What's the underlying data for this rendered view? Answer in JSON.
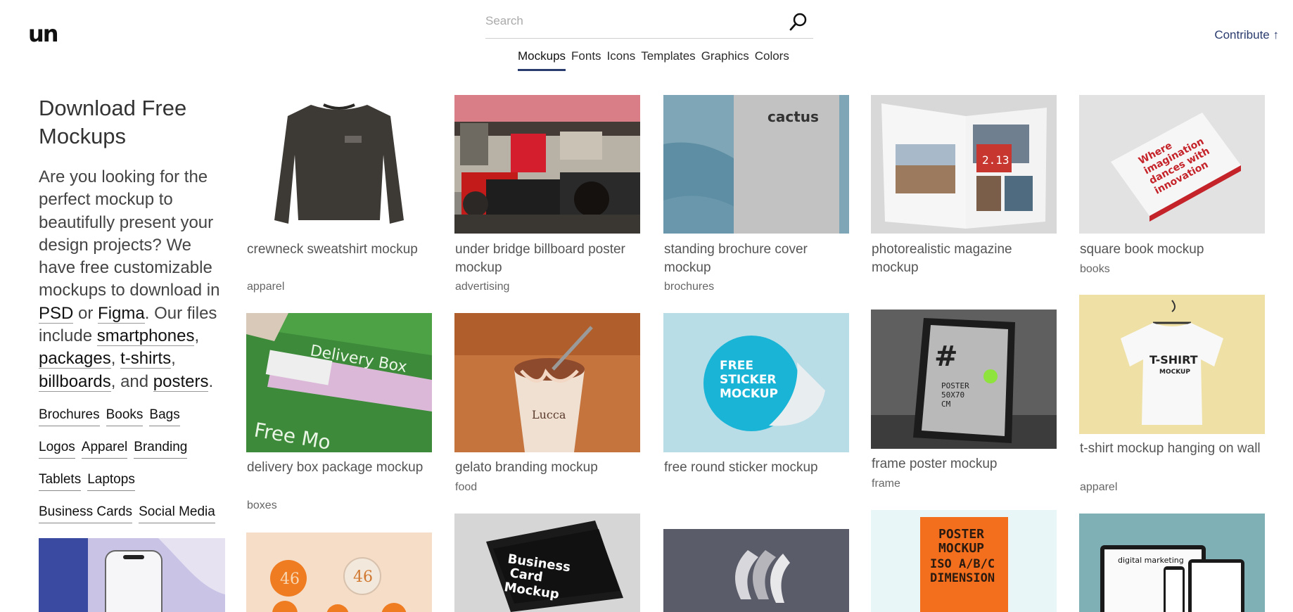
{
  "header": {
    "logo": "un",
    "search_placeholder": "Search",
    "contribute": "Contribute ↑"
  },
  "nav": {
    "tabs": [
      {
        "label": "Mockups",
        "active": true
      },
      {
        "label": "Fonts"
      },
      {
        "label": "Icons"
      },
      {
        "label": "Templates"
      },
      {
        "label": "Graphics"
      },
      {
        "label": "Colors"
      }
    ]
  },
  "sidebar": {
    "title": "Download Free Mockups",
    "intro": {
      "part1": "Are you looking for the perfect mockup to beautifully present your design projects? We have free customizable mockups to download in ",
      "psd": "PSD",
      "or": " or ",
      "figma": "Figma",
      "part2": ". Our files include ",
      "smartphones": "smartphones",
      "c1": ", ",
      "packages": "packages",
      "c2": ", ",
      "tshirts": "t-shirts",
      "c3": ", ",
      "billboards": "billboards",
      "and": ", and ",
      "posters": "posters",
      "end": "."
    },
    "tags": [
      [
        "Brochures",
        "Books",
        "Bags"
      ],
      [
        "Logos",
        "Apparel",
        "Branding"
      ],
      [
        "Tablets",
        "Laptops"
      ],
      [
        "Business Cards",
        "Social Media"
      ]
    ]
  },
  "cards": [
    {
      "title": "crewneck sweatshirt mockup",
      "tag": "apparel"
    },
    {
      "title": "under bridge billboard poster mockup",
      "tag": "advertising"
    },
    {
      "title": "standing brochure cover mockup",
      "tag": "brochures"
    },
    {
      "title": "photorealistic magazine mockup",
      "tag": ""
    },
    {
      "title": "square book mockup",
      "tag": "books"
    },
    {
      "title": "delivery box package mockup",
      "tag": "boxes"
    },
    {
      "title": "gelato branding mockup",
      "tag": "food"
    },
    {
      "title": "free round sticker mockup",
      "tag": ""
    },
    {
      "title": "frame poster mockup",
      "tag": "frame"
    },
    {
      "title": "t-shirt mockup hanging on wall",
      "tag": "apparel"
    }
  ],
  "image_text": {
    "cactus": "cactus",
    "book1": "Where",
    "book2": "imagination",
    "book3": "dances with",
    "book4": "innovation",
    "box1": "Delivery Box",
    "box2": "Free Mo",
    "cup": "Lucca",
    "sticker1": "FREE",
    "sticker2": "STICKER",
    "sticker3": "MOCKUP",
    "poster_num": "2.13",
    "frame1": "POSTER",
    "frame2": "50X70",
    "frame3": "CM",
    "tee1": "T-SHIRT",
    "tee2": "MOCKUP",
    "bc1": "Business",
    "bc2": "Card",
    "bc3": "Mockup",
    "op1": "POSTER",
    "op2": "MOCKUP",
    "op3": "ISO A/B/C",
    "op4": "DIMENSION",
    "dm1": "digital marketing",
    "pin": "46"
  }
}
